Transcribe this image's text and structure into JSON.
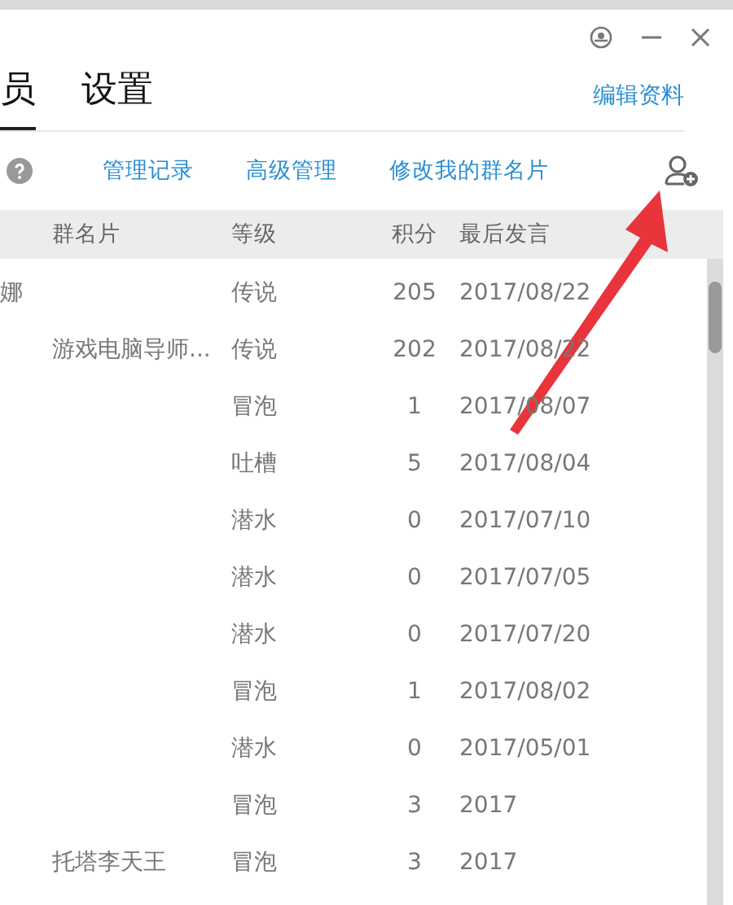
{
  "tabs": [
    {
      "label": "员",
      "selected": true
    },
    {
      "label": "设置",
      "selected": false
    }
  ],
  "edit_link": "编辑资料",
  "toolbar": {
    "links": [
      "管理记录",
      "高级管理",
      "修改我的群名片"
    ]
  },
  "table": {
    "columns": [
      "群名片",
      "等级",
      "积分",
      "最后发言"
    ],
    "rows": [
      {
        "name": "娜",
        "card": "",
        "level": "传说",
        "points": "205",
        "last": "2017/08/22"
      },
      {
        "name": "",
        "card": "游戏电脑导师...",
        "level": "传说",
        "points": "202",
        "last": "2017/08/22"
      },
      {
        "name": "",
        "card": "",
        "level": "冒泡",
        "points": "1",
        "last": "2017/08/07"
      },
      {
        "name": "",
        "card": "",
        "level": "吐槽",
        "points": "5",
        "last": "2017/08/04"
      },
      {
        "name": "",
        "card": "",
        "level": "潜水",
        "points": "0",
        "last": "2017/07/10"
      },
      {
        "name": "",
        "card": "",
        "level": "潜水",
        "points": "0",
        "last": "2017/07/05"
      },
      {
        "name": "",
        "card": "",
        "level": "潜水",
        "points": "0",
        "last": "2017/07/20"
      },
      {
        "name": "",
        "card": "",
        "level": "冒泡",
        "points": "1",
        "last": "2017/08/02"
      },
      {
        "name": "",
        "card": "",
        "level": "潜水",
        "points": "0",
        "last": "2017/05/01"
      },
      {
        "name": "",
        "card": "",
        "level": "冒泡",
        "points": "3",
        "last": "2017"
      },
      {
        "name": "",
        "card": "托塔李天王",
        "level": "冒泡",
        "points": "3",
        "last": "2017"
      }
    ]
  }
}
